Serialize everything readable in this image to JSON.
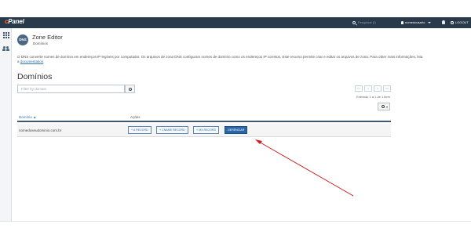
{
  "navbar": {
    "logo_c": "c",
    "logo_rest": "Panel",
    "search_placeholder": "Pesquisar (/)",
    "username": "nomedousario",
    "logout_label": "LOGOUT"
  },
  "header": {
    "badge": "DNS",
    "title": "Zone Editor",
    "subtitle": "Domínios"
  },
  "description": {
    "text": "O DNS converte nomes de domínio em endereços IP legíveis por computador. Os arquivos de zona DNS configuram nomes de domínio como os endereços IP corretos. Este recurso permite criar e editar os arquivos de zona. Para obter mais informações, leia a ",
    "link": "documentation",
    "end": "."
  },
  "section": {
    "title": "Domínios"
  },
  "filter": {
    "placeholder": "Filter by domain"
  },
  "pager": {
    "first": "<<",
    "prev": "<",
    "next": ">",
    "last": ">>",
    "count_text": "Exibindo 1 a 1 de 1 item"
  },
  "table": {
    "col_domain": "Domínio ▲",
    "col_actions": "Ações",
    "rows": [
      {
        "domain": "nomedoseudominio.com.br",
        "actions": [
          "+ A RECORD",
          "+ CNAME RECORD",
          "+ MX RECORD",
          "GERENCIAR"
        ]
      }
    ]
  },
  "colors": {
    "navbar": "#293a4a",
    "accent": "#2d72b8",
    "primary_button": "#2a67a8",
    "annotation_arrow": "#cc1f1f"
  }
}
